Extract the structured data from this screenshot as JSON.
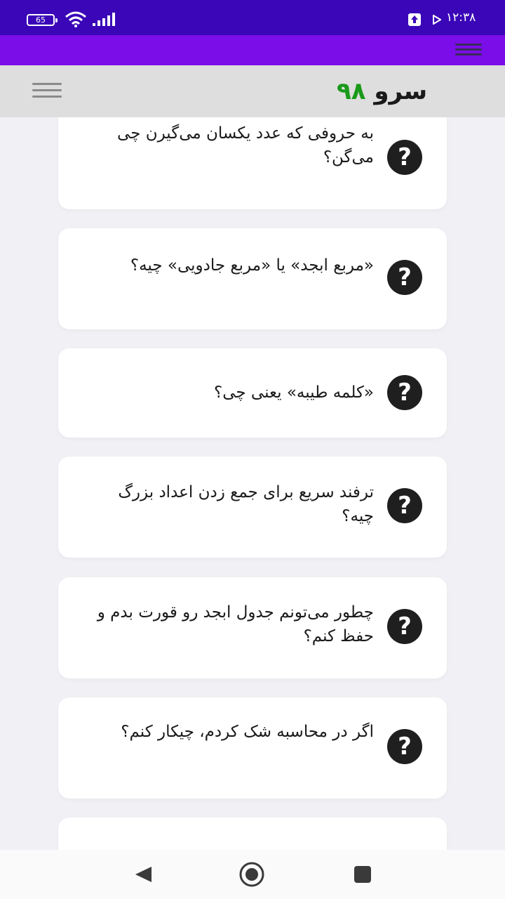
{
  "status_bar": {
    "battery": "65",
    "time": "۱۲:۳۸"
  },
  "header": {
    "logo_word": "سرو",
    "logo_number": "۹۸"
  },
  "questions": [
    {
      "text": "به حروفی که عدد یکسان می‌گیرن چی می‌گن؟"
    },
    {
      "text": "«مربع ابجد» یا «مربع جادویی» چیه؟"
    },
    {
      "text": "«کلمه طیبه» یعنی چی؟"
    },
    {
      "text": "ترفند سریع برای جمع زدن اعداد بزرگ چیه؟"
    },
    {
      "text": "چطور می‌تونم جدول ابجد رو قورت بدم و حفظ کنم؟"
    },
    {
      "text": "اگر در محاسبه شک کردم، چیکار کنم؟"
    }
  ],
  "icons": {
    "question": "question-mark-icon",
    "menu": "hamburger-icon"
  }
}
